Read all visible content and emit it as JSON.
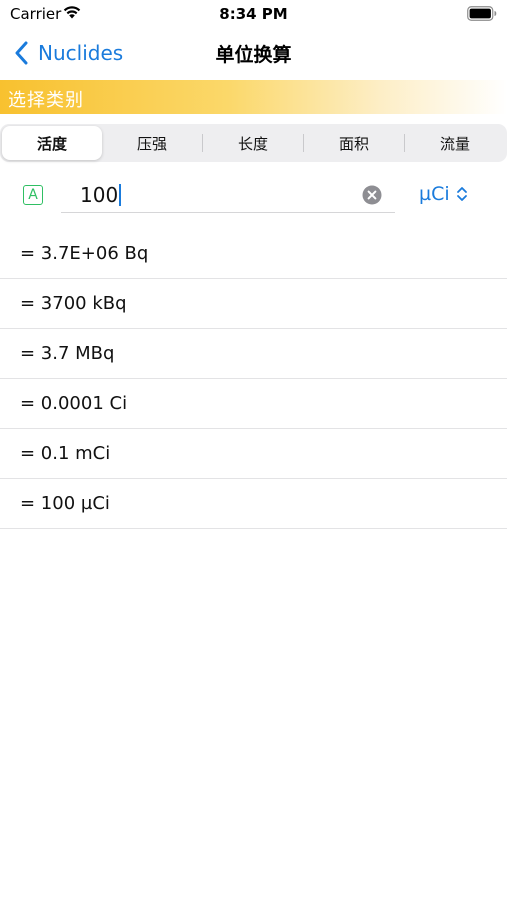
{
  "status_bar": {
    "carrier": "Carrier",
    "time": "8:34 PM"
  },
  "nav": {
    "back_label": "Nuclides",
    "title": "单位换算"
  },
  "section": {
    "label": "选择类别"
  },
  "categories": [
    {
      "label": "活度",
      "selected": true
    },
    {
      "label": "压强",
      "selected": false
    },
    {
      "label": "长度",
      "selected": false
    },
    {
      "label": "面积",
      "selected": false
    },
    {
      "label": "流量",
      "selected": false
    }
  ],
  "input": {
    "mode_badge": "A",
    "value": "100",
    "unit": "µCi"
  },
  "results": [
    "= 3.7E+06 Bq",
    "= 3700 kBq",
    "= 3.7 MBq",
    "= 0.0001 Ci",
    "= 0.1 mCi",
    "= 100 µCi"
  ],
  "colors": {
    "accent": "#1a7bdc",
    "badge": "#2fbf63",
    "header_gradient_start": "#f8c12f"
  },
  "icons": [
    "wifi-icon",
    "battery-icon",
    "back-chevron-icon",
    "clear-icon",
    "chevron-up-down-icon"
  ]
}
